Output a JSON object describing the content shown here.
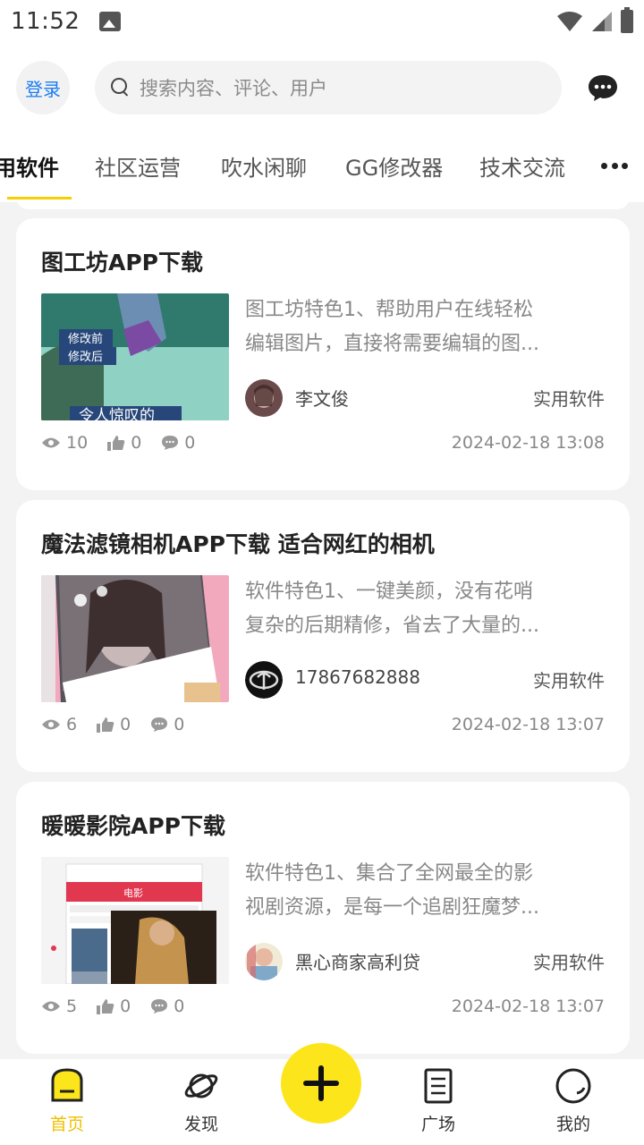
{
  "status_bar": {
    "time": "11:52"
  },
  "header": {
    "login_label": "登录",
    "search_placeholder": "搜索内容、评论、用户"
  },
  "tabs": [
    {
      "label": "用软件",
      "active": true
    },
    {
      "label": "社区运营",
      "active": false
    },
    {
      "label": "吹水闲聊",
      "active": false
    },
    {
      "label": "GG修改器",
      "active": false
    },
    {
      "label": "技术交流",
      "active": false
    }
  ],
  "posts": [
    {
      "title": "图工坊APP下载",
      "excerpt_lines": [
        "图工坊特色1、帮助用户在线轻松",
        "编辑图片，直接将需要编辑的图..."
      ],
      "thumb_text": [
        "修改前",
        "修改后",
        "令人惊叹的"
      ],
      "author": "李文俊",
      "category": "实用软件",
      "views": "10",
      "likes": "0",
      "comments": "0",
      "time": "2024-02-18 13:08"
    },
    {
      "title": "魔法滤镜相机APP下载 适合网红的相机",
      "excerpt_lines": [
        "软件特色1、一键美颜，没有花哨",
        "复杂的后期精修，省去了大量的..."
      ],
      "author": "17867682888",
      "category": "实用软件",
      "views": "6",
      "likes": "0",
      "comments": "0",
      "time": "2024-02-18 13:07"
    },
    {
      "title": "暖暖影院APP下载",
      "excerpt_lines": [
        "软件特色1、集合了全网最全的影",
        "视剧资源，是每一个追剧狂魔梦..."
      ],
      "thumb_text": [
        "电影"
      ],
      "author": "黑心商家高利贷",
      "category": "实用软件",
      "views": "5",
      "likes": "0",
      "comments": "0",
      "time": "2024-02-18 13:07"
    }
  ],
  "bottom_nav": {
    "home": "首页",
    "discover": "发现",
    "square": "广场",
    "mine": "我的"
  },
  "colors": {
    "accent": "#fde51c",
    "active_nav": "#f0c000",
    "link": "#1a7cf3"
  }
}
